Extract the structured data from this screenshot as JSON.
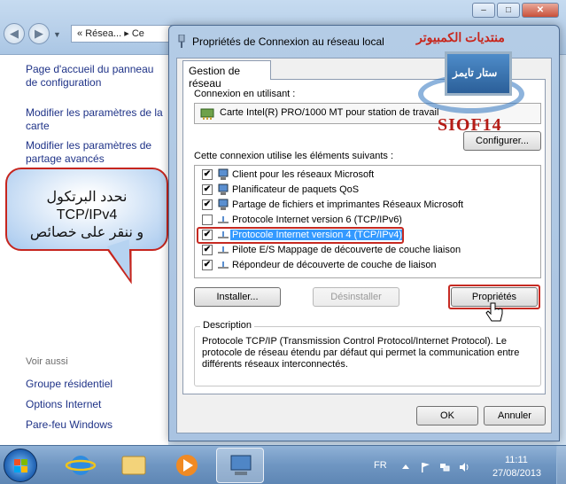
{
  "background": {
    "address_parts": [
      "«",
      "Résea...",
      "▸",
      "Ce"
    ],
    "window_controls": [
      "–",
      "□",
      "✕"
    ],
    "left_links": [
      "Page d'accueil du panneau de configuration",
      "Modifier les paramètres de la carte",
      "Modifier les paramètres de partage avancés"
    ],
    "see_also_title": "Voir aussi",
    "see_also_links": [
      "Groupe résidentiel",
      "Options Internet",
      "Pare-feu Windows"
    ]
  },
  "bubble": {
    "line1": "نحدد البرتكول",
    "line2": "TCP/IPv4",
    "line3": "و ننقر على خصائص"
  },
  "dialog": {
    "title": "Propriétés de Connexion au réseau local",
    "tab": "Gestion de réseau",
    "connect_using_label": "Connexion en utilisant :",
    "adapter": "Carte Intel(R) PRO/1000 MT pour station de travail",
    "configure_button": "Configurer...",
    "items_label": "Cette connexion utilise les éléments suivants :",
    "items": [
      {
        "label": "Client pour les réseaux Microsoft",
        "checked": true,
        "icon": "network-client-icon"
      },
      {
        "label": "Planificateur de paquets QoS",
        "checked": true,
        "icon": "qos-scheduler-icon"
      },
      {
        "label": "Partage de fichiers et imprimantes Réseaux Microsoft",
        "checked": true,
        "icon": "file-printer-sharing-icon"
      },
      {
        "label": "Protocole Internet version 6 (TCP/IPv6)",
        "checked": false,
        "icon": "protocol-icon"
      },
      {
        "label": "Protocole Internet version 4 (TCP/IPv4)",
        "checked": true,
        "icon": "protocol-icon",
        "selected": true
      },
      {
        "label": "Pilote E/S Mappage de découverte de couche liaison",
        "checked": true,
        "icon": "protocol-icon"
      },
      {
        "label": "Répondeur de découverte de couche de liaison",
        "checked": true,
        "icon": "protocol-icon"
      }
    ],
    "install_button": "Installer...",
    "uninstall_button": "Désinstaller",
    "properties_button": "Propriétés",
    "description_legend": "Description",
    "description": "Protocole TCP/IP (Transmission Control Protocol/Internet Protocol). Le protocole de réseau étendu par défaut qui permet la communication entre différents réseaux interconnectés.",
    "ok_button": "OK",
    "cancel_button": "Annuler"
  },
  "watermark": {
    "title": "منتديات الكمبيوتر",
    "screen_text": "ستار تايمز",
    "brand": "SIOF14"
  },
  "taskbar": {
    "lang": "FR",
    "time": "11:11",
    "date": "27/08/2013"
  },
  "colors": {
    "highlight_red": "#c62a22",
    "selection_blue": "#3399ff",
    "link_blue": "#1e3287"
  }
}
